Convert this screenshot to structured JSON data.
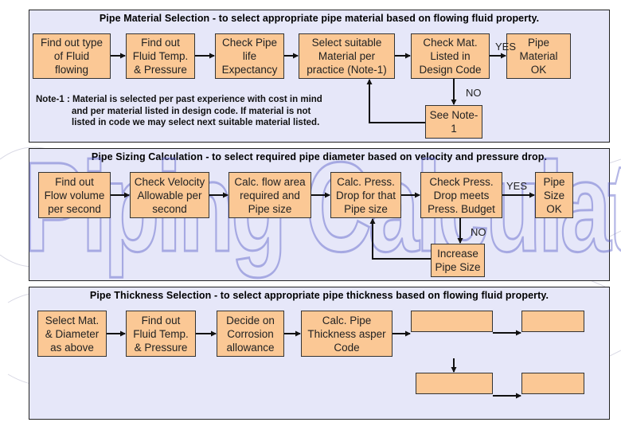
{
  "watermark": "Piping Calculations",
  "panels": [
    {
      "title": "Pipe Material Selection - to select appropriate pipe material based on flowing fluid property.",
      "boxes": [
        "Find out type\nof Fluid\nflowing",
        "Find out\nFluid Temp.\n& Pressure",
        "Check Pipe\nlife\nExpectancy",
        "Select suitable\nMaterial per\npractice (Note-1)",
        "Check Mat.\nListed in\nDesign Code",
        "Pipe\nMaterial\nOK",
        "See Note-\n1"
      ],
      "yes_label": "YES",
      "no_label": "NO",
      "note_label": "Note-1 :",
      "note_lines": [
        "Material is selected per past experience with cost in mind",
        "and per material listed in design code. If material is not",
        "listed in code we may select next suitable material listed."
      ]
    },
    {
      "title": "Pipe Sizing Calculation - to select required pipe diameter based on velocity and pressure drop.",
      "boxes": [
        "Find out\nFlow volume\nper second",
        "Check Velocity\nAllowable per\nsecond",
        "Calc. flow area\nrequired and\nPipe size",
        "Calc. Press.\nDrop for that\nPipe size",
        "Check Press.\nDrop meets\nPress. Budget",
        "Pipe\nSize\nOK",
        "Increase\nPipe Size"
      ],
      "yes_label": "YES",
      "no_label": "NO"
    },
    {
      "title": "Pipe Thickness Selection - to select appropriate pipe thickness based on flowing fluid property.",
      "boxes": [
        "Select Mat.\n& Diameter\nas above",
        "Find out\nFluid Temp.\n& Pressure",
        "Decide  on\nCorrosion\nallowance",
        "Calc. Pipe\nThickness asper\nCode",
        "",
        "",
        "",
        ""
      ]
    }
  ],
  "colors": {
    "panel_bg": "#e6e7f9",
    "box_fill": "#fbc895",
    "watermark_stroke": "#5a5fc8"
  }
}
